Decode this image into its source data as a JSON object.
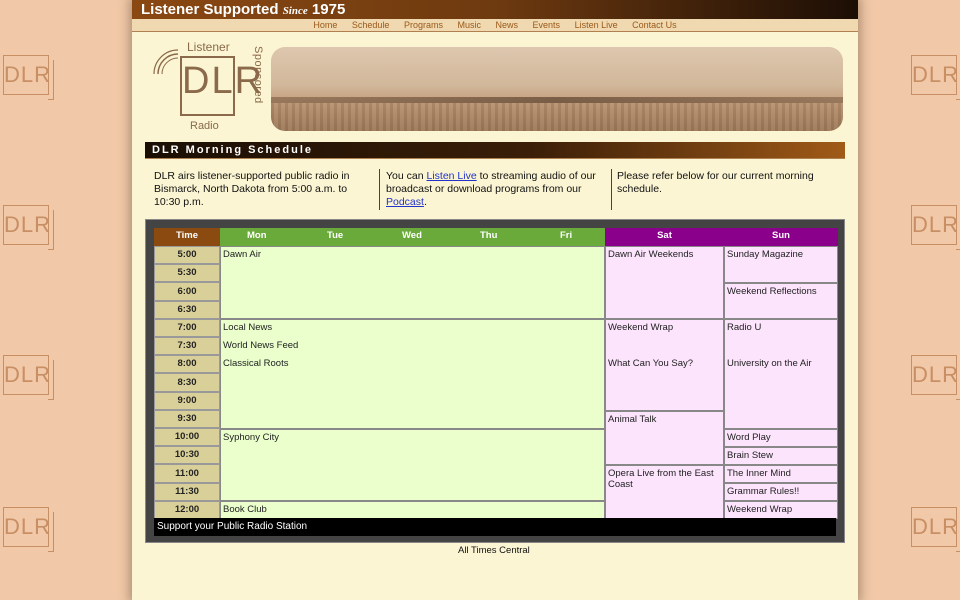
{
  "banner": {
    "text_main": "Listener Supported",
    "text_since": "Since",
    "text_year": "1975"
  },
  "nav": [
    "Home",
    "Schedule",
    "Programs",
    "Music",
    "News",
    "Events",
    "Listen Live",
    "Contact Us"
  ],
  "logo": {
    "top_word": "Listener",
    "letters": "DLR",
    "bottom_word": "Radio",
    "side_word": "Sponsored"
  },
  "background_logo": "DLR",
  "page_heading": "DLR Morning Schedule",
  "intro": {
    "col1": "DLR airs listener-supported public radio in Bismarck, North Dakota from 5:00 a.m. to 10:30 p.m.",
    "col2_prefix": "You can",
    "col2_link1": "Listen Live",
    "col2_middle": "to streaming audio of our broadcast or download programs from our",
    "col2_link2": "Podcast",
    "col2_suffix": ".",
    "col3": "Please refer below for our current morning schedule."
  },
  "schedule": {
    "headers": {
      "time": "Time",
      "mon": "Mon",
      "tue": "Tue",
      "wed": "Wed",
      "thu": "Thu",
      "fri": "Fri",
      "sat": "Sat",
      "sun": "Sun"
    },
    "times": [
      "5:00",
      "5:30",
      "6:00",
      "6:30",
      "7:00",
      "7:30",
      "8:00",
      "8:30",
      "9:00",
      "9:30",
      "10:00",
      "10:30",
      "11:00",
      "11:30",
      "12:00"
    ],
    "weekday": [
      "Dawn Air",
      "Local News",
      "World News Feed",
      "Classical Roots",
      "Syphony City",
      "Book Club"
    ],
    "saturday": [
      "Dawn Air Weekends",
      "Weekend Wrap",
      "What Can You Say?",
      "Animal Talk",
      "Opera Live from the East Coast"
    ],
    "sunday": [
      "Sunday Magazine",
      "Weekend Reflections",
      "Radio U",
      "University on the Air",
      "Word Play",
      "Brain Stew",
      "The Inner Mind",
      "Grammar Rules!!",
      "Weekend Wrap"
    ],
    "support_text": "Support your Public Radio Station"
  },
  "footer_note": "All Times Central",
  "colors": {
    "header_time": "#8a4a10",
    "header_week": "#6aaa3a",
    "header_weekend": "#8b008b",
    "weekday_bg": "#eaffcc",
    "weekend_bg": "#fce4fc",
    "time_bg": "#d9d099"
  }
}
